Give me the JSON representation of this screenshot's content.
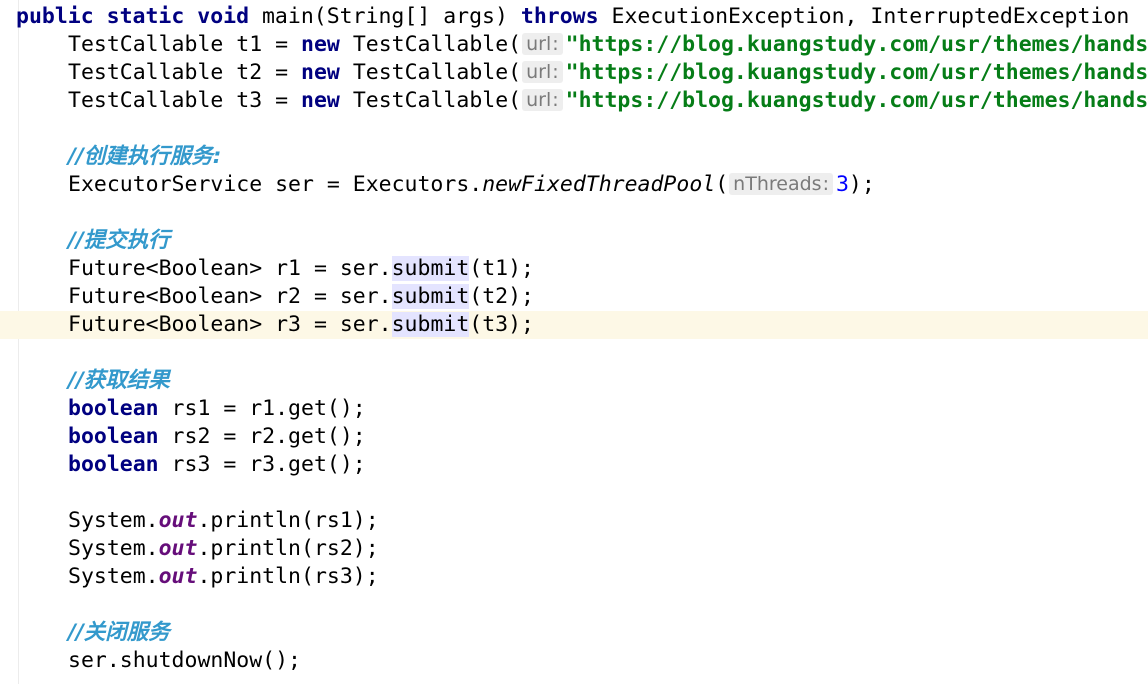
{
  "editor": {
    "theme_colors": {
      "keyword": "#000080",
      "string": "#067d17",
      "comment": "#3399cc",
      "field": "#660e7a",
      "number": "#0000ff",
      "current_line": "#fdf8e6",
      "usage_highlight": "#e4e4ff",
      "hint_background": "#eeeeee"
    },
    "method_signature": {
      "kw_public": "public",
      "kw_static": "static",
      "kw_void": "void",
      "signature": "main(String[] args)",
      "kw_throws": "throws",
      "exceptions": "ExecutionException, InterruptedException"
    },
    "callables": [
      {
        "type": "TestCallable",
        "var": "t1",
        "kw_new": "new",
        "ctor": "TestCallable(",
        "hint": "url",
        "url": "\"https://blog.kuangstudy.com/usr/themes/hands"
      },
      {
        "type": "TestCallable",
        "var": "t2",
        "kw_new": "new",
        "ctor": "TestCallable(",
        "hint": "url",
        "url": "\"https://blog.kuangstudy.com/usr/themes/hands"
      },
      {
        "type": "TestCallable",
        "var": "t3",
        "kw_new": "new",
        "ctor": "TestCallable(",
        "hint": "url",
        "url": "\"https://blog.kuangstudy.com/usr/themes/hands"
      }
    ],
    "comment_create_service": "//创建执行服务:",
    "executor_line": {
      "prefix": "ExecutorService ser = Executors.",
      "method": "newFixedThreadPool",
      "open_paren": "(",
      "hint": "nThreads",
      "arg": "3",
      "close": ");"
    },
    "comment_submit": "//提交执行",
    "futures": [
      {
        "prefix": "Future<Boolean> r1 = ser.",
        "method": "submit",
        "args": "(t1);"
      },
      {
        "prefix": "Future<Boolean> r2 = ser.",
        "method": "submit",
        "args": "(t2);"
      },
      {
        "prefix": "Future<Boolean> r3 = ser.",
        "method": "submit",
        "args": "(t3);"
      }
    ],
    "comment_get_result": "//获取结果",
    "results": [
      {
        "kw": "boolean",
        "rest": " rs1 = r1.get();"
      },
      {
        "kw": "boolean",
        "rest": " rs2 = r2.get();"
      },
      {
        "kw": "boolean",
        "rest": " rs3 = r3.get();"
      }
    ],
    "prints": [
      {
        "prefix": "System.",
        "field": "out",
        "rest": ".println(rs1);"
      },
      {
        "prefix": "System.",
        "field": "out",
        "rest": ".println(rs2);"
      },
      {
        "prefix": "System.",
        "field": "out",
        "rest": ".println(rs3);"
      }
    ],
    "comment_shutdown": "//关闭服务",
    "shutdown_line": "ser.shutdownNow();"
  }
}
